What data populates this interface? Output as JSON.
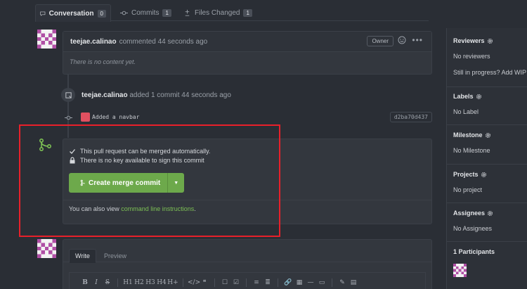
{
  "tabs": [
    {
      "label": "Conversation",
      "count": "0"
    },
    {
      "label": "Commits",
      "count": "1"
    },
    {
      "label": "Files Changed",
      "count": "1"
    }
  ],
  "comment": {
    "author": "teejae.calinao",
    "meta": "commented 44 seconds ago",
    "badge": "Owner",
    "body": "There is no content yet."
  },
  "event": {
    "author": "teejae.calinao",
    "text": "added 1 commit 44 seconds ago"
  },
  "commit": {
    "message": "Added a navbar",
    "sha": "d2ba70d437"
  },
  "merge": {
    "line1": "This pull request can be merged automatically.",
    "line2": "There is no key available to sign this commit",
    "button": "Create merge commit",
    "foot_prefix": "You can also view",
    "foot_link": "command line instructions",
    "foot_suffix": "."
  },
  "editor": {
    "tab_write": "Write",
    "tab_preview": "Preview",
    "toolbar": [
      "B",
      "I",
      "S",
      "H1",
      "H2",
      "H3",
      "H4",
      "H+",
      "</>",
      "❝",
      "☐",
      "☑",
      "≡",
      "≣",
      "🔗",
      "▦",
      "—",
      "▭",
      "✎",
      "▤"
    ]
  },
  "sidebar": {
    "reviewers_title": "Reviewers",
    "reviewers_val": "No reviewers",
    "wip_text": "Still in progress? Add WIP",
    "labels_title": "Labels",
    "labels_val": "No Label",
    "milestone_title": "Milestone",
    "milestone_val": "No Milestone",
    "projects_title": "Projects",
    "projects_val": "No project",
    "assignees_title": "Assignees",
    "assignees_val": "No Assignees",
    "participants_title": "1 Participants"
  },
  "colors": {
    "accent": "#6da94b",
    "highlight": "#e8202a"
  }
}
